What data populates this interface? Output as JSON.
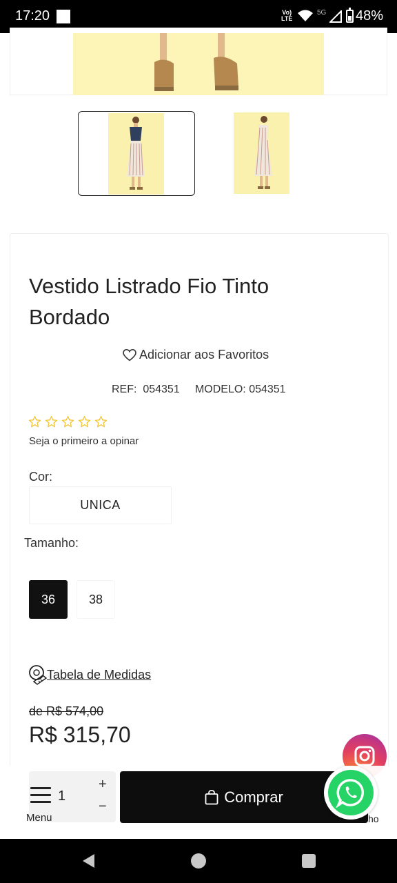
{
  "status_bar": {
    "time": "17:20",
    "volte_line1": "Vo)",
    "volte_line2": "LTE",
    "network": "5G",
    "battery": "48%",
    "battery_level": 0.48
  },
  "product": {
    "title": "Vestido Listrado Fio Tinto Bordado",
    "favorite_label": "Adicionar aos Favoritos",
    "ref_line": "REF:  054351     MODELO: 054351",
    "rating_stars": 0,
    "rating_max": 5,
    "review_cta": "Seja o primeiro a opinar",
    "color_label": "Cor:",
    "color_value": "UNICA",
    "size_label": "Tamanho:",
    "sizes": [
      "36",
      "38"
    ],
    "selected_size": "36",
    "measures_label": "Tabela de Medidas",
    "old_price": "de R$ 574,00",
    "price": "R$ 315,70"
  },
  "bottom_bar": {
    "quantity": "1",
    "plus": "+",
    "minus": "−",
    "menu_label": "Menu",
    "buy_label": "Comprar",
    "cart_label": "ho"
  },
  "colors": {
    "photo_background": "#fdf5b8",
    "buy_button": "#0d0d0d",
    "selected_size": "#111111",
    "star_outline": "#f2c230",
    "whatsapp": "#25d366"
  }
}
